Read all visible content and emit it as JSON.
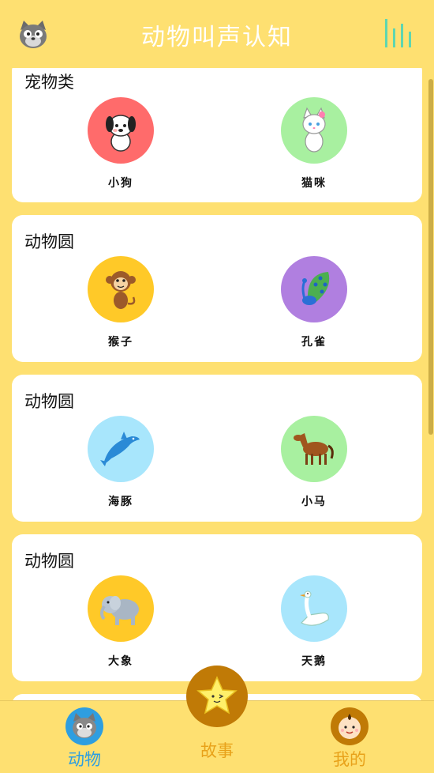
{
  "header": {
    "title": "动物叫声认知",
    "avatar_icon": "cat-face-icon",
    "menu_icon": "equalizer-bars-icon"
  },
  "colors": {
    "background": "#FEE071",
    "card": "#FFFFFF",
    "circle_red": "#FF6B6B",
    "circle_green": "#A8F0A0",
    "circle_yellow": "#FFC928",
    "circle_purple": "#B07FE0",
    "circle_blue": "#A8E6FC",
    "tab_active": "#2E9EE0",
    "tab_inactive": "#E8A21A"
  },
  "sections": [
    {
      "title": "宠物类",
      "animals": [
        {
          "name": "小狗",
          "icon": "puppy-icon"
        },
        {
          "name": "猫咪",
          "icon": "kitten-icon"
        }
      ]
    },
    {
      "title": "动物圆",
      "animals": [
        {
          "name": "猴子",
          "icon": "monkey-icon"
        },
        {
          "name": "孔雀",
          "icon": "peacock-icon"
        }
      ]
    },
    {
      "title": "动物圆",
      "animals": [
        {
          "name": "海豚",
          "icon": "dolphin-icon"
        },
        {
          "name": "小马",
          "icon": "horse-icon"
        }
      ]
    },
    {
      "title": "动物圆",
      "animals": [
        {
          "name": "大象",
          "icon": "elephant-icon"
        },
        {
          "name": "天鹅",
          "icon": "swan-icon"
        }
      ]
    }
  ],
  "tabs": [
    {
      "label": "动物",
      "icon": "cat-face-icon",
      "active": true
    },
    {
      "label": "故事",
      "icon": "star-icon",
      "active": false
    },
    {
      "label": "我的",
      "icon": "baby-face-icon",
      "active": false
    }
  ]
}
